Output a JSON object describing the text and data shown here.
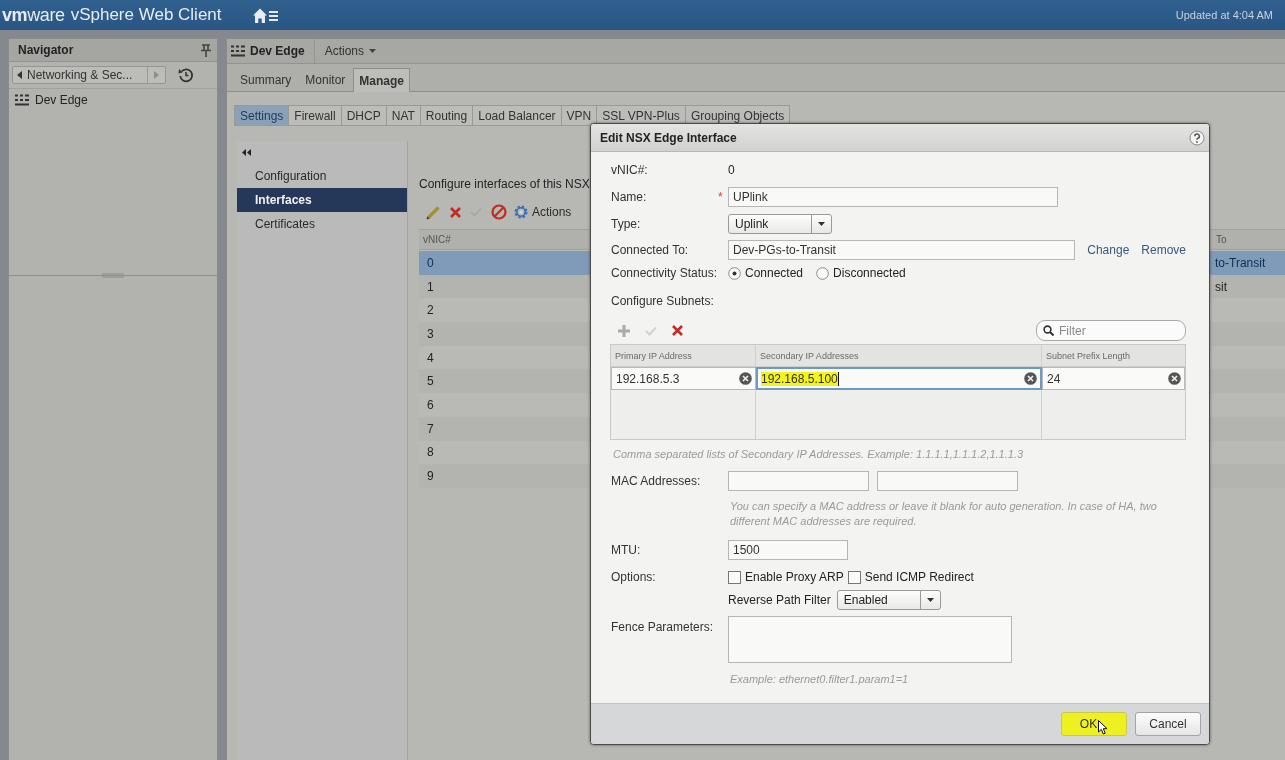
{
  "window": {
    "logo": "**vm**ware",
    "title": "vSphere Web Client",
    "status": "Updated at 4:04 AM"
  },
  "navigator": {
    "title": "Navigator",
    "breadcrumb": "Networking & Sec...",
    "items": [
      {
        "label": "Dev Edge",
        "selected": false
      }
    ]
  },
  "object_header": {
    "title": "Dev Edge",
    "actions": "Actions"
  },
  "tabs": [
    {
      "label": "Summary",
      "selected": false
    },
    {
      "label": "Monitor",
      "selected": false
    },
    {
      "label": "Manage",
      "selected": true
    }
  ],
  "subtabs": [
    {
      "label": "Settings",
      "selected": true
    },
    {
      "label": "Firewall",
      "selected": false
    },
    {
      "label": "DHCP",
      "selected": false
    },
    {
      "label": "NAT",
      "selected": false
    },
    {
      "label": "Routing",
      "selected": false
    },
    {
      "label": "Load Balancer",
      "selected": false
    },
    {
      "label": "VPN",
      "selected": false
    },
    {
      "label": "SSL VPN-Plus",
      "selected": false
    },
    {
      "label": "Grouping Objects",
      "selected": false
    }
  ],
  "side_menu": [
    {
      "label": "Configuration",
      "selected": false
    },
    {
      "label": "Interfaces",
      "selected": true
    },
    {
      "label": "Certificates",
      "selected": false
    }
  ],
  "interfaces": {
    "description": "Configure interfaces of this NSX",
    "toolbar": [
      {
        "kind": "edit",
        "disabled": false
      },
      {
        "kind": "delete",
        "disabled": false
      },
      {
        "kind": "accept",
        "disabled": true
      },
      {
        "kind": "disable",
        "disabled": false
      },
      {
        "kind": "actions",
        "label": "Actions",
        "disabled": false
      }
    ],
    "columns": [
      "vNIC#",
      "To"
    ],
    "rows": [
      {
        "cells": [
          "0",
          "to-Transit"
        ],
        "selected": true
      },
      {
        "cells": [
          "1",
          "sit"
        ],
        "selected": false
      },
      {
        "cells": [
          "2"
        ],
        "selected": false
      },
      {
        "cells": [
          "3"
        ],
        "selected": false
      },
      {
        "cells": [
          "4"
        ],
        "selected": false
      },
      {
        "cells": [
          "5"
        ],
        "selected": false
      },
      {
        "cells": [
          "6"
        ],
        "selected": false
      },
      {
        "cells": [
          "7"
        ],
        "selected": false
      },
      {
        "cells": [
          "8"
        ],
        "selected": false
      },
      {
        "cells": [
          "9"
        ],
        "selected": false
      }
    ]
  },
  "dialog": {
    "title": "Edit NSX Edge Interface",
    "vnic": {
      "label": "vNIC#:",
      "value": "0"
    },
    "name": {
      "label": "Name:",
      "required_mark": "*",
      "value": "UPlink"
    },
    "type": {
      "label": "Type:",
      "value": "Uplink"
    },
    "connected_to": {
      "label": "Connected To:",
      "value": "Dev-PGs-to-Transit",
      "links": [
        "Change",
        "Remove"
      ]
    },
    "connectivity_status": {
      "label": "Connectivity Status:",
      "options": [
        {
          "label": "Connected",
          "selected": true
        },
        {
          "label": "Disconnected",
          "selected": false
        }
      ]
    },
    "subnets": {
      "label": "Configure Subnets:",
      "toolbar": [
        {
          "kind": "add",
          "disabled": true
        },
        {
          "kind": "accept",
          "disabled": true
        },
        {
          "kind": "delete",
          "disabled": false
        }
      ],
      "filter": {
        "placeholder": "Filter"
      },
      "columns": [
        "Primary IP Address",
        "Secondary IP Addresses",
        "Subnet Prefix Length"
      ],
      "rows": [
        {
          "cells": [
            {
              "value": "192.168.5.3",
              "focused": false,
              "highlighted": false
            },
            {
              "value": "192.168.5.100",
              "focused": true,
              "highlighted": true
            },
            {
              "value": "24",
              "focused": false,
              "highlighted": false
            }
          ]
        }
      ],
      "hint": "Comma separated lists of Secondary IP Addresses. Example: 1.1.1.1,1.1.1.2,1.1.1.3"
    },
    "mac_addresses": {
      "label": "MAC Addresses:",
      "hint": "You can specify a MAC address or leave it blank for auto generation. In case of HA, two different MAC addresses are required."
    },
    "mtu": {
      "label": "MTU:",
      "value": "1500"
    },
    "options": {
      "label": "Options:",
      "checkboxes": [
        {
          "label": "Enable Proxy ARP",
          "checked": false
        },
        {
          "label": "Send ICMP Redirect",
          "checked": false
        }
      ],
      "reverse_path_filter": {
        "label": "Reverse Path Filter",
        "value": "Enabled"
      }
    },
    "fence_parameters": {
      "label": "Fence Parameters:",
      "hint": "Example: ethernet0.filter1.param1=1"
    },
    "buttons": [
      {
        "label": "OK",
        "highlighted": true
      },
      {
        "label": "Cancel",
        "highlighted": false
      }
    ]
  }
}
